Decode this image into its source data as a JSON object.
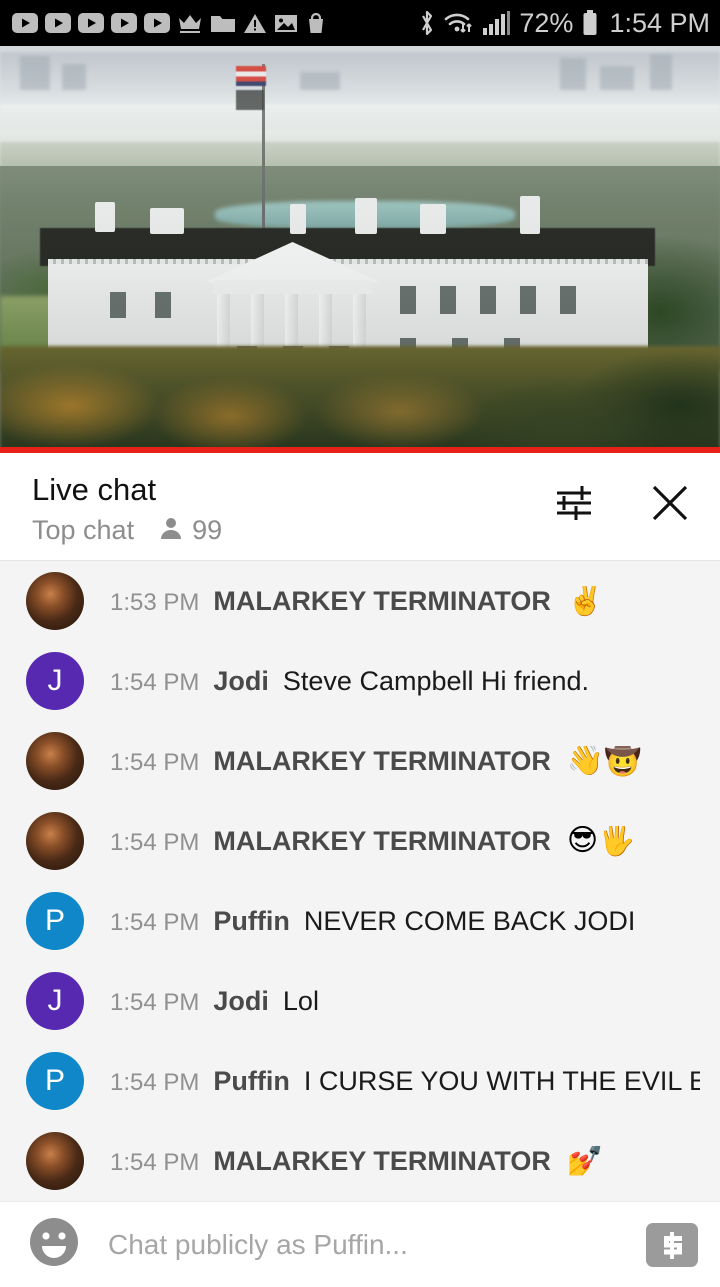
{
  "statusbar": {
    "left_icons": [
      "youtube-play-icon",
      "youtube-play-icon",
      "youtube-play-icon",
      "youtube-play-icon",
      "youtube-play-icon",
      "crown-icon",
      "folder-icon",
      "warning-triangle-icon",
      "image-icon",
      "shopping-bag-icon"
    ],
    "bluetooth": "bluetooth-icon",
    "wifi": "wifi-icon",
    "signal": "signal-bars-icon",
    "battery_percent": "72%",
    "battery": "battery-icon",
    "time": "1:54 PM",
    "bg_color": "#000000",
    "fg_color": "#c4c4c4"
  },
  "video": {
    "name": "white-house-live-stream",
    "progress_color": "#e62117",
    "progress_percent": 100
  },
  "chat": {
    "title": "Live chat",
    "mode": "Top chat",
    "viewer_count": "99",
    "settings_icon": "tune-sliders-icon",
    "close_icon": "close-x-icon",
    "messages": [
      {
        "time": "1:53 PM",
        "author": "MALARKEY TERMINATOR",
        "text": "",
        "emoji": "✌️",
        "avatar_type": "photo",
        "avatar_letter": "",
        "avatar_color": "#7a4a28"
      },
      {
        "time": "1:54 PM",
        "author": "Jodi",
        "text": "Steve Campbell Hi friend.",
        "emoji": "",
        "avatar_type": "letter",
        "avatar_letter": "J",
        "avatar_color": "#5729b0"
      },
      {
        "time": "1:54 PM",
        "author": "MALARKEY TERMINATOR",
        "text": "",
        "emoji": "👋🤠",
        "avatar_type": "photo",
        "avatar_letter": "",
        "avatar_color": "#7a4a28"
      },
      {
        "time": "1:54 PM",
        "author": "MALARKEY TERMINATOR",
        "text": "",
        "emoji": "😎🖐️",
        "avatar_type": "photo",
        "avatar_letter": "",
        "avatar_color": "#7a4a28"
      },
      {
        "time": "1:54 PM",
        "author": "Puffin",
        "text": "NEVER COME BACK JODI",
        "emoji": "",
        "avatar_type": "letter",
        "avatar_letter": "P",
        "avatar_color": "#1087c8"
      },
      {
        "time": "1:54 PM",
        "author": "Jodi",
        "text": "Lol",
        "emoji": "",
        "avatar_type": "letter",
        "avatar_letter": "J",
        "avatar_color": "#5729b0"
      },
      {
        "time": "1:54 PM",
        "author": "Puffin",
        "text": "I CURSE YOU WITH THE EVIL EYE",
        "emoji": "",
        "avatar_type": "letter",
        "avatar_letter": "P",
        "avatar_color": "#1087c8"
      },
      {
        "time": "1:54 PM",
        "author": "MALARKEY TERMINATOR",
        "text": "",
        "emoji": "💅",
        "avatar_type": "photo",
        "avatar_letter": "",
        "avatar_color": "#7a4a28"
      }
    ]
  },
  "input": {
    "emoji_icon": "emoji-smiley-icon",
    "placeholder": "Chat publicly as Puffin...",
    "value": "",
    "superchat_icon": "dollar-superchat-icon"
  }
}
